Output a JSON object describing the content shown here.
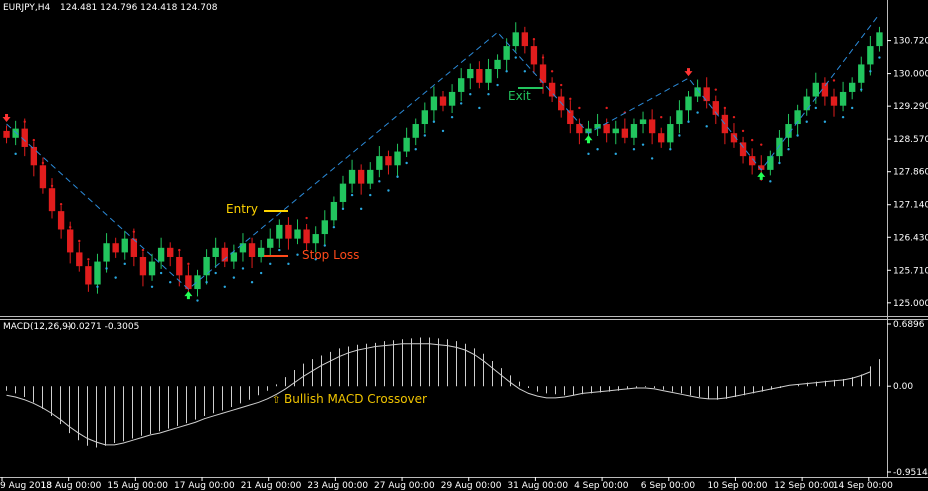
{
  "header": {
    "symbol": "EURJPY,H4",
    "ohlc": "124.481 124.796 124.418 124.708"
  },
  "macd_header": {
    "label": "MACD(12,26,9)",
    "values": "-0.0271 -0.3005"
  },
  "colors": {
    "background": "#000000",
    "bull": "#22c55e",
    "bear": "#e11d1d",
    "dots_bull": "#29a8e0",
    "dots_bear": "#e11d1d",
    "zigzag": "#2b8ad8",
    "entry": "#ffd400",
    "stop": "#ff4a1a",
    "exit_text": "#22c55e",
    "annotation": "#f0c400",
    "axis": "#ffffff",
    "arrow_up": "#22ff55",
    "arrow_down": "#ff3333"
  },
  "annotations": {
    "entry": "Entry",
    "stop_loss": "Stop Loss",
    "exit": "Exit",
    "macd_cross": "Bullish MACD Crossover"
  },
  "chart_data": [
    {
      "type": "candlestick",
      "title": "EURJPY,H4",
      "y_ticks": [
        "130.720",
        "130.000",
        "129.290",
        "128.570",
        "127.860",
        "127.140",
        "126.430",
        "125.710",
        "125.000"
      ],
      "x_ticks": [
        "9 Aug 2018",
        "13 Aug 00:00",
        "15 Aug 00:00",
        "17 Aug 00:00",
        "21 Aug 00:00",
        "23 Aug 00:00",
        "27 Aug 00:00",
        "29 Aug 00:00",
        "31 Aug 00:00",
        "4 Sep 00:00",
        "6 Sep 00:00",
        "10 Sep 00:00",
        "12 Sep 00:00",
        "14 Sep 00:00"
      ],
      "ylim": [
        124.8,
        131.3
      ],
      "closes": [
        128.6,
        128.8,
        128.4,
        128.0,
        127.5,
        127.0,
        126.6,
        126.1,
        125.8,
        125.4,
        125.9,
        126.3,
        126.1,
        126.4,
        126.0,
        125.6,
        125.9,
        126.2,
        126.0,
        125.6,
        125.3,
        125.6,
        126.0,
        126.2,
        125.9,
        126.1,
        126.3,
        126.0,
        126.2,
        126.4,
        126.7,
        126.4,
        126.6,
        126.3,
        126.5,
        126.8,
        127.2,
        127.6,
        127.9,
        127.6,
        127.9,
        128.2,
        128.0,
        128.3,
        128.6,
        128.9,
        129.2,
        129.5,
        129.3,
        129.6,
        129.9,
        130.1,
        129.8,
        130.1,
        130.3,
        130.6,
        130.9,
        130.6,
        130.2,
        129.8,
        129.5,
        129.2,
        128.9,
        128.7,
        128.8,
        128.9,
        128.7,
        128.8,
        128.6,
        128.9,
        129.0,
        128.7,
        128.5,
        128.9,
        129.2,
        129.5,
        129.7,
        129.4,
        129.1,
        128.7,
        128.5,
        128.2,
        128.0,
        127.9,
        128.2,
        128.6,
        128.9,
        129.2,
        129.5,
        129.8,
        129.5,
        129.3,
        129.6,
        129.8,
        130.2,
        130.6,
        130.9
      ]
    },
    {
      "type": "bar",
      "title": "MACD(12,26,9)",
      "y_ticks": [
        "0.6896",
        "0.00",
        "-0.9514"
      ],
      "ylim": [
        -0.9514,
        0.6896
      ],
      "histogram": [
        -0.05,
        -0.08,
        -0.12,
        -0.18,
        -0.25,
        -0.33,
        -0.42,
        -0.52,
        -0.6,
        -0.66,
        -0.68,
        -0.66,
        -0.63,
        -0.61,
        -0.58,
        -0.55,
        -0.53,
        -0.5,
        -0.47,
        -0.44,
        -0.41,
        -0.37,
        -0.33,
        -0.3,
        -0.27,
        -0.23,
        -0.19,
        -0.15,
        -0.1,
        -0.05,
        0.02,
        0.1,
        0.18,
        0.25,
        0.3,
        0.34,
        0.38,
        0.42,
        0.44,
        0.46,
        0.47,
        0.48,
        0.5,
        0.51,
        0.52,
        0.53,
        0.54,
        0.54,
        0.53,
        0.52,
        0.5,
        0.47,
        0.42,
        0.36,
        0.28,
        0.2,
        0.12,
        0.05,
        -0.02,
        -0.06,
        -0.08,
        -0.09,
        -0.1,
        -0.1,
        -0.09,
        -0.08,
        -0.07,
        -0.06,
        -0.05,
        -0.03,
        -0.02,
        -0.01,
        -0.02,
        -0.04,
        -0.06,
        -0.08,
        -0.1,
        -0.12,
        -0.14,
        -0.15,
        -0.14,
        -0.12,
        -0.1,
        -0.08,
        -0.06,
        -0.04,
        -0.02,
        0.0,
        0.02,
        0.04,
        0.05,
        0.06,
        0.07,
        0.08,
        0.1,
        0.13,
        0.22,
        0.3
      ],
      "signal": [
        -0.1,
        -0.12,
        -0.15,
        -0.19,
        -0.24,
        -0.3,
        -0.37,
        -0.45,
        -0.52,
        -0.58,
        -0.62,
        -0.65,
        -0.65,
        -0.63,
        -0.6,
        -0.57,
        -0.54,
        -0.52,
        -0.49,
        -0.46,
        -0.43,
        -0.4,
        -0.36,
        -0.33,
        -0.3,
        -0.27,
        -0.24,
        -0.21,
        -0.18,
        -0.14,
        -0.09,
        -0.03,
        0.04,
        0.11,
        0.17,
        0.23,
        0.28,
        0.33,
        0.37,
        0.4,
        0.42,
        0.44,
        0.45,
        0.46,
        0.47,
        0.47,
        0.47,
        0.47,
        0.46,
        0.45,
        0.43,
        0.4,
        0.35,
        0.28,
        0.2,
        0.12,
        0.04,
        -0.03,
        -0.08,
        -0.11,
        -0.13,
        -0.13,
        -0.12,
        -0.1,
        -0.08,
        -0.07,
        -0.06,
        -0.05,
        -0.04,
        -0.03,
        -0.02,
        -0.02,
        -0.03,
        -0.05,
        -0.07,
        -0.09,
        -0.11,
        -0.13,
        -0.14,
        -0.14,
        -0.13,
        -0.11,
        -0.09,
        -0.07,
        -0.05,
        -0.03,
        -0.01,
        0.01,
        0.02,
        0.03,
        0.04,
        0.05,
        0.06,
        0.07,
        0.09,
        0.12,
        0.16
      ]
    }
  ]
}
